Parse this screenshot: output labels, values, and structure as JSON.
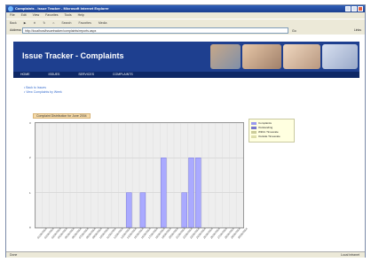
{
  "window": {
    "title": "Complaints - Issue Tracker - Microsoft Internet Explorer"
  },
  "menu": [
    "File",
    "Edit",
    "View",
    "Favorites",
    "Tools",
    "Help"
  ],
  "toolbar": {
    "back": "Back",
    "search": "Search",
    "favorites": "Favorites",
    "media": "Media"
  },
  "address": {
    "label": "Address",
    "url": "http://localhost/issuetracker/complaints/reports.aspx",
    "go": "Go",
    "links": "Links"
  },
  "page": {
    "banner_title": "Issue Tracker - Complaints",
    "nav": [
      "HOME",
      "ISSUES",
      "SERVICES",
      "COMPLAINTS"
    ],
    "sublinks": [
      "Back to Issues",
      "View Complaints by Week"
    ],
    "chart_title": "Complaint Distribution for June 2004"
  },
  "chart_data": {
    "type": "bar",
    "categories": [
      "01",
      "02",
      "03",
      "04",
      "05",
      "06",
      "07",
      "08",
      "09",
      "10",
      "11",
      "12",
      "13",
      "14",
      "15",
      "16",
      "17",
      "18",
      "19",
      "20",
      "21",
      "22",
      "23",
      "24",
      "25",
      "26",
      "27",
      "28",
      "29",
      "30"
    ],
    "series": [
      {
        "name": "Complaints",
        "values": [
          0,
          0,
          0,
          0,
          0,
          0,
          0,
          0,
          0,
          0,
          0,
          0,
          0,
          1,
          0,
          1,
          0,
          0,
          2,
          0,
          0,
          1,
          2,
          2,
          0,
          0,
          0,
          0,
          0,
          0
        ],
        "color": "#aaaaff"
      }
    ],
    "ylim": [
      0,
      3
    ],
    "yticks": [
      "0",
      "1",
      "2",
      "3"
    ],
    "legend": [
      {
        "label": "Complaints",
        "color": "#9999ee"
      },
      {
        "label": "Outstanding",
        "color": "#7777cc"
      },
      {
        "label": "Within Timescale",
        "color": "#cccc99"
      },
      {
        "label": "Outside Timescale",
        "color": "#ddddaa"
      }
    ],
    "grid": true,
    "legend_placement": "right"
  },
  "status": {
    "left": "Done",
    "right": "Local intranet"
  }
}
